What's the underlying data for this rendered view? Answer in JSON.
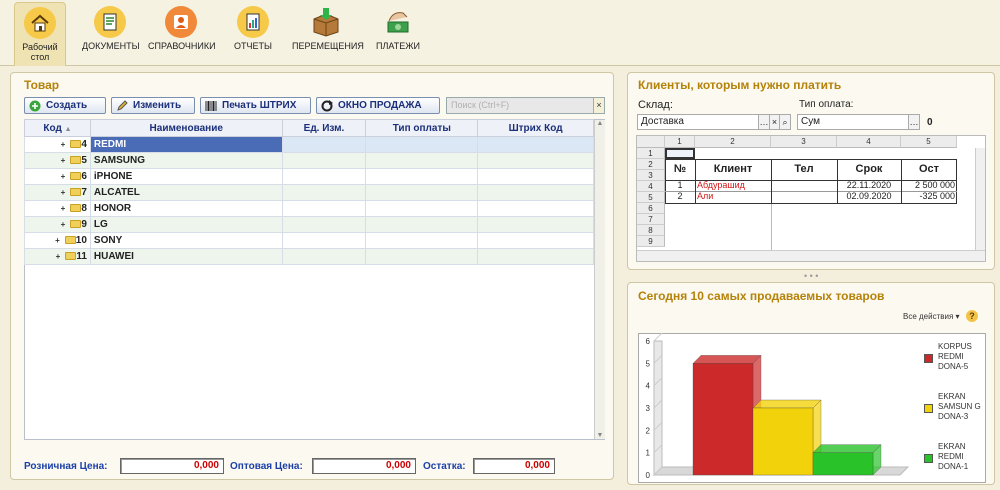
{
  "nav": [
    {
      "label": "Рабочий стол",
      "icon": "home-icon"
    },
    {
      "label": "ДОКУМЕНТЫ",
      "icon": "documents-icon"
    },
    {
      "label": "СПРАВОЧНИКИ",
      "icon": "catalogs-icon"
    },
    {
      "label": "ОТЧЕТЫ",
      "icon": "reports-icon"
    },
    {
      "label": "ПЕРЕМЕЩЕНИЯ",
      "icon": "transfer-box-icon"
    },
    {
      "label": "ПЛАТЕЖИ",
      "icon": "payments-icon"
    }
  ],
  "products": {
    "title": "Товар",
    "toolbar": {
      "create": "Создать",
      "edit": "Изменить",
      "print_barcode": "Печать ШТРИХ",
      "sales_window": "ОКНО ПРОДАЖА",
      "search_placeholder": "Поиск (Ctrl+F)",
      "search_clear": "×"
    },
    "columns": [
      "Код",
      "Наименование",
      "Ед. Изм.",
      "Тип оплаты",
      "Штрих Код"
    ],
    "rows": [
      {
        "code": "4",
        "name": "REDMI"
      },
      {
        "code": "5",
        "name": "SAMSUNG"
      },
      {
        "code": "6",
        "name": "iPHONE"
      },
      {
        "code": "7",
        "name": "ALCATEL"
      },
      {
        "code": "8",
        "name": "HONOR"
      },
      {
        "code": "9",
        "name": "LG"
      },
      {
        "code": "10",
        "name": "SONY"
      },
      {
        "code": "11",
        "name": "HUAWEI"
      }
    ],
    "footer": {
      "retail_label": "Розничная Цена:",
      "retail_value": "0,000",
      "wholesale_label": "Оптовая Цена:",
      "wholesale_value": "0,000",
      "stock_label": "Остатка:",
      "stock_value": "0,000"
    }
  },
  "clients": {
    "title": "Клиенты, которым нужно платить",
    "warehouse_label": "Склад:",
    "warehouse_value": "Доставка",
    "paytype_label": "Тип оплата:",
    "paytype_value": "Сум",
    "paytype_extra": "0",
    "sheet_cols": [
      "1",
      "2",
      "3",
      "4",
      "5"
    ],
    "sheet_rows": [
      "1",
      "2",
      "3",
      "4",
      "5",
      "6",
      "7",
      "8",
      "9"
    ],
    "table_headers": [
      "№",
      "Клиент",
      "Тел",
      "Срок",
      "Ост"
    ],
    "table_rows": [
      {
        "n": "1",
        "client": "Абдурашид",
        "tel": "",
        "date": "22.11.2020",
        "balance": "2 500 000"
      },
      {
        "n": "2",
        "client": "Али",
        "tel": "",
        "date": "02.09.2020",
        "balance": "-325 000"
      }
    ],
    "accent_red": "#d01818"
  },
  "top_products": {
    "title": "Сегодня 10 самых продаваемых товаров",
    "actions_label": "Все действия ▾",
    "help_label": "?"
  },
  "chart_data": {
    "type": "bar",
    "categories": [
      "KORPUS REDMI DONA-5",
      "EKRAN SAMSUNG DONA-3",
      "EKRAN REDMI DONA-1"
    ],
    "values": [
      5,
      3,
      1
    ],
    "colors": [
      "#cc2a2a",
      "#f2d20a",
      "#29c229"
    ],
    "ylim": [
      0,
      6
    ],
    "yticks": [
      "0",
      "1",
      "2",
      "3",
      "4",
      "5",
      "6"
    ],
    "legend": [
      {
        "label": "KORPUS REDMI DONA-5",
        "color": "#cc2a2a"
      },
      {
        "label": "EKRAN SAMSUN G DONA-3",
        "color": "#f2d20a"
      },
      {
        "label": "EKRAN REDMI DONA-1",
        "color": "#29c229"
      }
    ],
    "legend_position": "right",
    "grid": false,
    "style": "3d"
  }
}
